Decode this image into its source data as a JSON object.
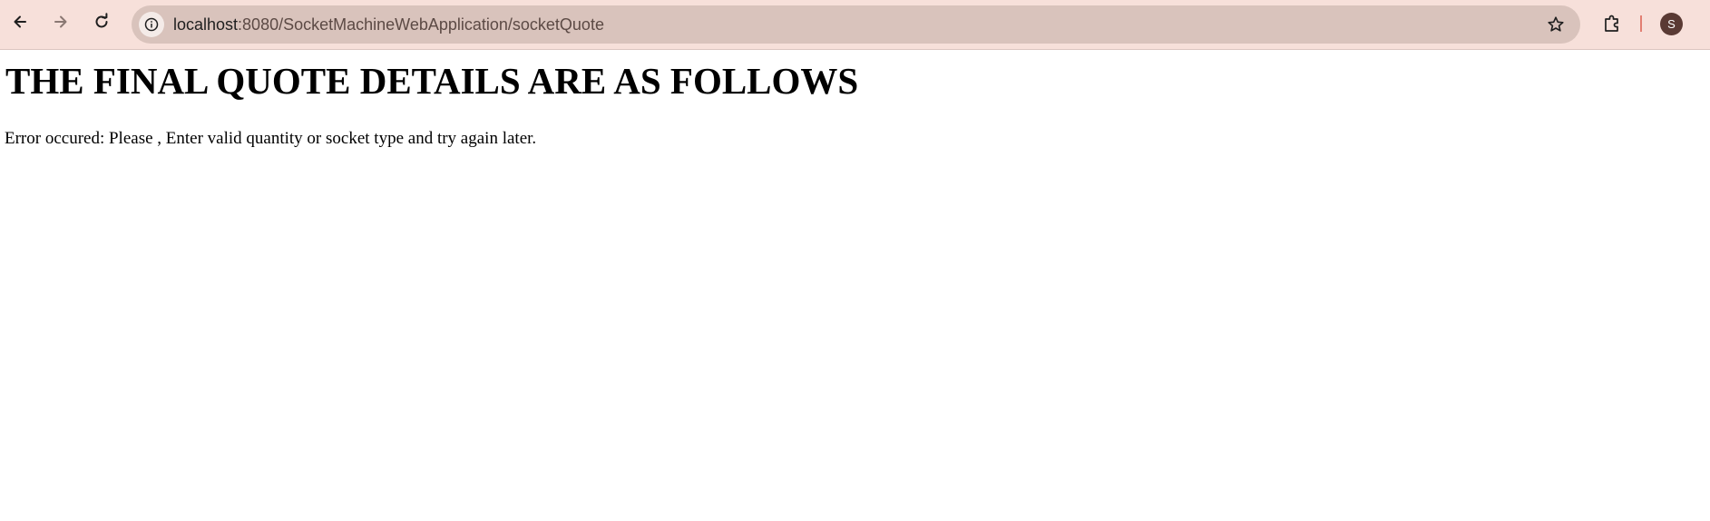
{
  "browser": {
    "url_host": "localhost",
    "url_rest": ":8080/SocketMachineWebApplication/socketQuote",
    "profile_initial": "S",
    "accent_color": "#f7e0da",
    "icons": {
      "back": "back-arrow-icon",
      "forward": "forward-arrow-icon",
      "reload": "reload-icon",
      "site_info": "info-icon",
      "bookmark": "star-icon",
      "extensions": "puzzle-icon"
    }
  },
  "page": {
    "title": "THE FINAL QUOTE DETAILS ARE AS FOLLOWS",
    "message": "Error occured: Please , Enter valid quantity or socket type and try again later."
  }
}
